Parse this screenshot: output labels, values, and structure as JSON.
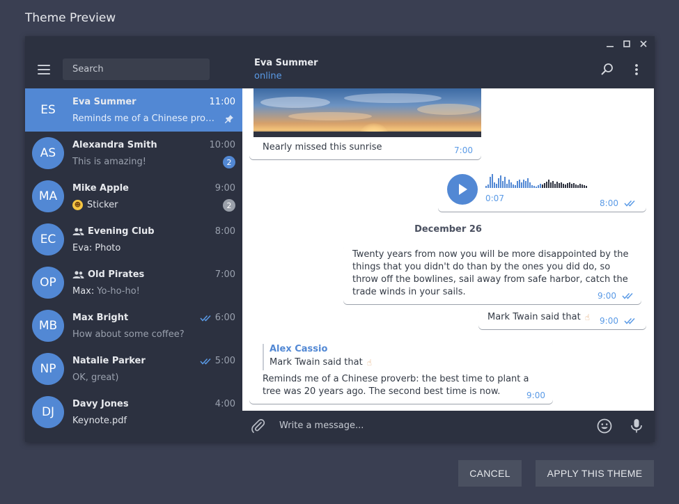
{
  "page": {
    "title": "Theme Preview"
  },
  "sidebar": {
    "search_placeholder": "Search",
    "chats": [
      {
        "initials": "ES",
        "name": "Eva Summer",
        "time": "11:00",
        "preview": "Reminds me of a Chinese proverb: the best time to plant a tree",
        "pinned": true,
        "active": true
      },
      {
        "initials": "AS",
        "name": "Alexandra Smith",
        "time": "10:00",
        "preview": "This is amazing!",
        "badge": "2"
      },
      {
        "initials": "MA",
        "name": "Mike Apple",
        "time": "9:00",
        "preview": "Sticker",
        "badge": "2",
        "badge_muted": true,
        "sticker": true
      },
      {
        "initials": "EC",
        "name": "Evening Club",
        "time": "8:00",
        "preview_author": "Eva:",
        "preview": "Photo",
        "group": true
      },
      {
        "initials": "OP",
        "name": "Old Pirates",
        "time": "7:00",
        "preview_author": "Max:",
        "preview": "Yo-ho-ho!",
        "group": true
      },
      {
        "initials": "MB",
        "name": "Max Bright",
        "time": "6:00",
        "preview": "How about some coffee?",
        "read": true
      },
      {
        "initials": "NP",
        "name": "Natalie Parker",
        "time": "5:00",
        "preview": "OK, great)",
        "read": true
      },
      {
        "initials": "DJ",
        "name": "Davy Jones",
        "time": "4:00",
        "preview": "Keynote.pdf",
        "preview_light": true
      }
    ]
  },
  "chat": {
    "peer_name": "Eva Summer",
    "peer_status": "online",
    "messages": {
      "photo_caption": "Nearly missed this sunrise",
      "photo_time": "7:00",
      "voice_duration": "0:07",
      "voice_time": "8:00",
      "date_separator": "December 26",
      "quote_text": "Twenty years from now you will be more disappointed by the things that you didn't do than by the ones you did do, so throw off the bowlines, sail away from safe harbor, catch the trade winds in your sails.",
      "quote_time": "9:00",
      "twain_text": "Mark Twain said that",
      "twain_time": "9:00",
      "reply_author": "Alex Cassio",
      "reply_quoted": "Mark Twain said that",
      "reply_text": "Reminds me of a Chinese proverb: the best time to plant a tree was 20 years ago. The second best time is now.",
      "reply_time": "9:00"
    },
    "composer_placeholder": "Write a message..."
  },
  "dialog": {
    "cancel_label": "CANCEL",
    "apply_label": "APPLY THIS THEME"
  },
  "colors": {
    "accent": "#5288d4",
    "background": "#3a3f52",
    "window": "#2c3140",
    "chat_bg": "#ffffff"
  }
}
